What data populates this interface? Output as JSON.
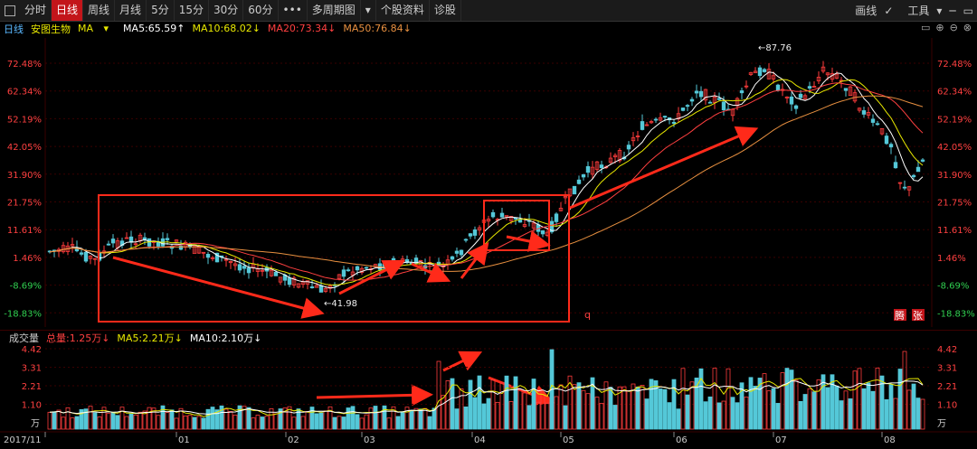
{
  "toolbar": {
    "tabs": [
      "分时",
      "日线",
      "周线",
      "月线",
      "5分",
      "15分",
      "30分",
      "60分",
      "•••",
      "多周期图",
      "▾",
      "个股资料",
      "诊股"
    ],
    "active_tab": "日线",
    "right": {
      "draw": "画线",
      "draw_arrow": "✓",
      "tools": "工具",
      "tools_arrow": "▾"
    }
  },
  "ma_line": {
    "period": "日线",
    "stock": "安图生物",
    "indicator": "MA",
    "indicator_arrow": "▾",
    "ma5": "MA5:65.59↑",
    "ma10": "MA10:68.02↓",
    "ma20": "MA20:73.34↓",
    "ma50": "MA50:76.84↓",
    "colors": {
      "ma5": "#ffffff",
      "ma10": "#e8e800",
      "ma20": "#ff4040",
      "ma50": "#e89040"
    }
  },
  "price_labels": [
    "72.48%",
    "62.34%",
    "52.19%",
    "42.05%",
    "31.90%",
    "21.75%",
    "11.61%",
    "1.46%",
    "-8.69%",
    "-18.83%"
  ],
  "annotations": {
    "high": "←87.76",
    "low": "←41.98",
    "q": "q",
    "badge1": "腾",
    "badge2": "张"
  },
  "volume": {
    "title": "成交量",
    "total": "总量:1.25万↓",
    "ma5": "MA5:2.21万↓",
    "ma10": "MA10:2.10万↓",
    "labels": [
      "4.42",
      "3.31",
      "2.21",
      "1.10"
    ],
    "unit": "万"
  },
  "x_labels": [
    "2017/11",
    "01",
    "02",
    "03",
    "04",
    "05",
    "06",
    "07",
    "08"
  ],
  "icons": [
    "layout-icon",
    "window-minimize-icon",
    "window-restore-icon",
    "zoom-in-icon",
    "zoom-out-icon",
    "close-icon"
  ],
  "colors": {
    "up": "#ff3c3c",
    "down": "#54c8d8",
    "grid": "#3a0000",
    "annotation": "#ff2a1a"
  }
}
